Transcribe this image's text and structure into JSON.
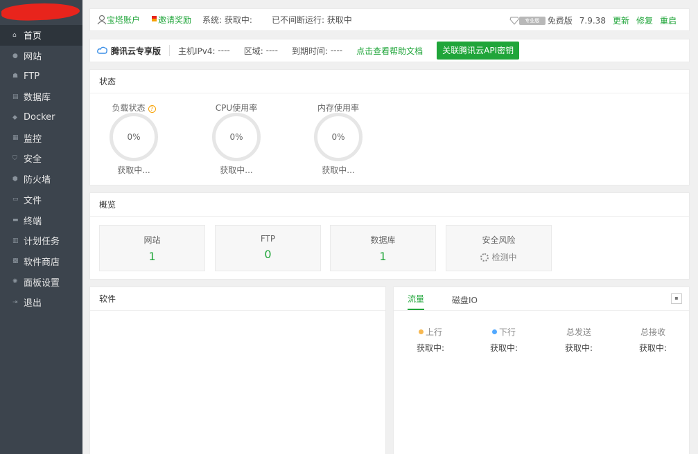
{
  "sidebar": {
    "items": [
      {
        "label": "首页",
        "icon": "home-icon",
        "glyph": "⌂",
        "active": true
      },
      {
        "label": "网站",
        "icon": "globe-icon",
        "glyph": "●"
      },
      {
        "label": "FTP",
        "icon": "ftp-icon",
        "glyph": "☗"
      },
      {
        "label": "数据库",
        "icon": "database-icon",
        "glyph": "▤"
      },
      {
        "label": "Docker",
        "icon": "docker-icon",
        "glyph": "◆"
      },
      {
        "label": "监控",
        "icon": "monitor-icon",
        "glyph": "▦"
      },
      {
        "label": "安全",
        "icon": "shield-icon",
        "glyph": "⛉"
      },
      {
        "label": "防火墙",
        "icon": "firewall-icon",
        "glyph": "⬢"
      },
      {
        "label": "文件",
        "icon": "folder-icon",
        "glyph": "▭"
      },
      {
        "label": "终端",
        "icon": "terminal-icon",
        "glyph": "▬"
      },
      {
        "label": "计划任务",
        "icon": "schedule-icon",
        "glyph": "▥"
      },
      {
        "label": "软件商店",
        "icon": "apps-icon",
        "glyph": "▩"
      },
      {
        "label": "面板设置",
        "icon": "gear-icon",
        "glyph": "✺"
      },
      {
        "label": "退出",
        "icon": "logout-icon",
        "glyph": "⇥"
      }
    ]
  },
  "topbar": {
    "account": "宝塔账户",
    "invite": "邀请奖励",
    "system_label": "系统:",
    "system_value": "获取中:",
    "uptime": "已不间断运行: 获取中",
    "edition": "免费版",
    "version": "7.9.38",
    "update": "更新",
    "repair": "修复",
    "restart": "重启",
    "pro_badge": "专业版"
  },
  "cloudbar": {
    "brand": "腾讯云专享版",
    "ipv4_label": "主机IPv4:",
    "ipv4_value": "----",
    "region_label": "区域:",
    "region_value": "----",
    "expire_label": "到期时间:",
    "expire_value": "----",
    "help_link": "点击查看帮助文档",
    "api_button": "关联腾讯云API密钥"
  },
  "status": {
    "title": "状态",
    "gauges": [
      {
        "label": "负载状态",
        "value": "0%",
        "state": "获取中..."
      },
      {
        "label": "CPU使用率",
        "value": "0%",
        "state": "获取中..."
      },
      {
        "label": "内存使用率",
        "value": "0%",
        "state": "获取中..."
      }
    ],
    "help": "?"
  },
  "overview": {
    "title": "概览",
    "boxes": [
      {
        "label": "网站",
        "value": "1"
      },
      {
        "label": "FTP",
        "value": "0"
      },
      {
        "label": "数据库",
        "value": "1"
      },
      {
        "label": "安全风险",
        "value": "检测中"
      }
    ]
  },
  "software": {
    "title": "软件"
  },
  "traffic": {
    "tabs": [
      "流量",
      "磁盘IO"
    ],
    "mini_button": "▪",
    "columns": [
      {
        "label": "上行",
        "value": "获取中:",
        "dot": "#f7b851"
      },
      {
        "label": "下行",
        "value": "获取中:",
        "dot": "#52a9ff"
      },
      {
        "label": "总发送",
        "value": "获取中:"
      },
      {
        "label": "总接收",
        "value": "获取中:"
      }
    ]
  },
  "colors": {
    "accent": "#20a53a",
    "sidebar": "#3c444d",
    "sidebar_active": "#2d343b"
  }
}
